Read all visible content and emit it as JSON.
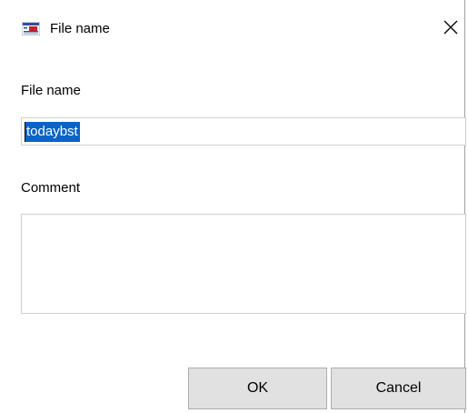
{
  "window": {
    "title": "File name",
    "icon": "app-logo-icon",
    "close_icon": "close-icon"
  },
  "form": {
    "file_name_label": "File name",
    "file_name_value": "todaybst",
    "comment_label": "Comment",
    "comment_value": ""
  },
  "buttons": {
    "ok_label": "OK",
    "cancel_label": "Cancel"
  },
  "colors": {
    "selection": "#0a63c9",
    "button_bg": "#e1e1e1",
    "button_border": "#adadad",
    "field_border": "#d0d0d0"
  }
}
